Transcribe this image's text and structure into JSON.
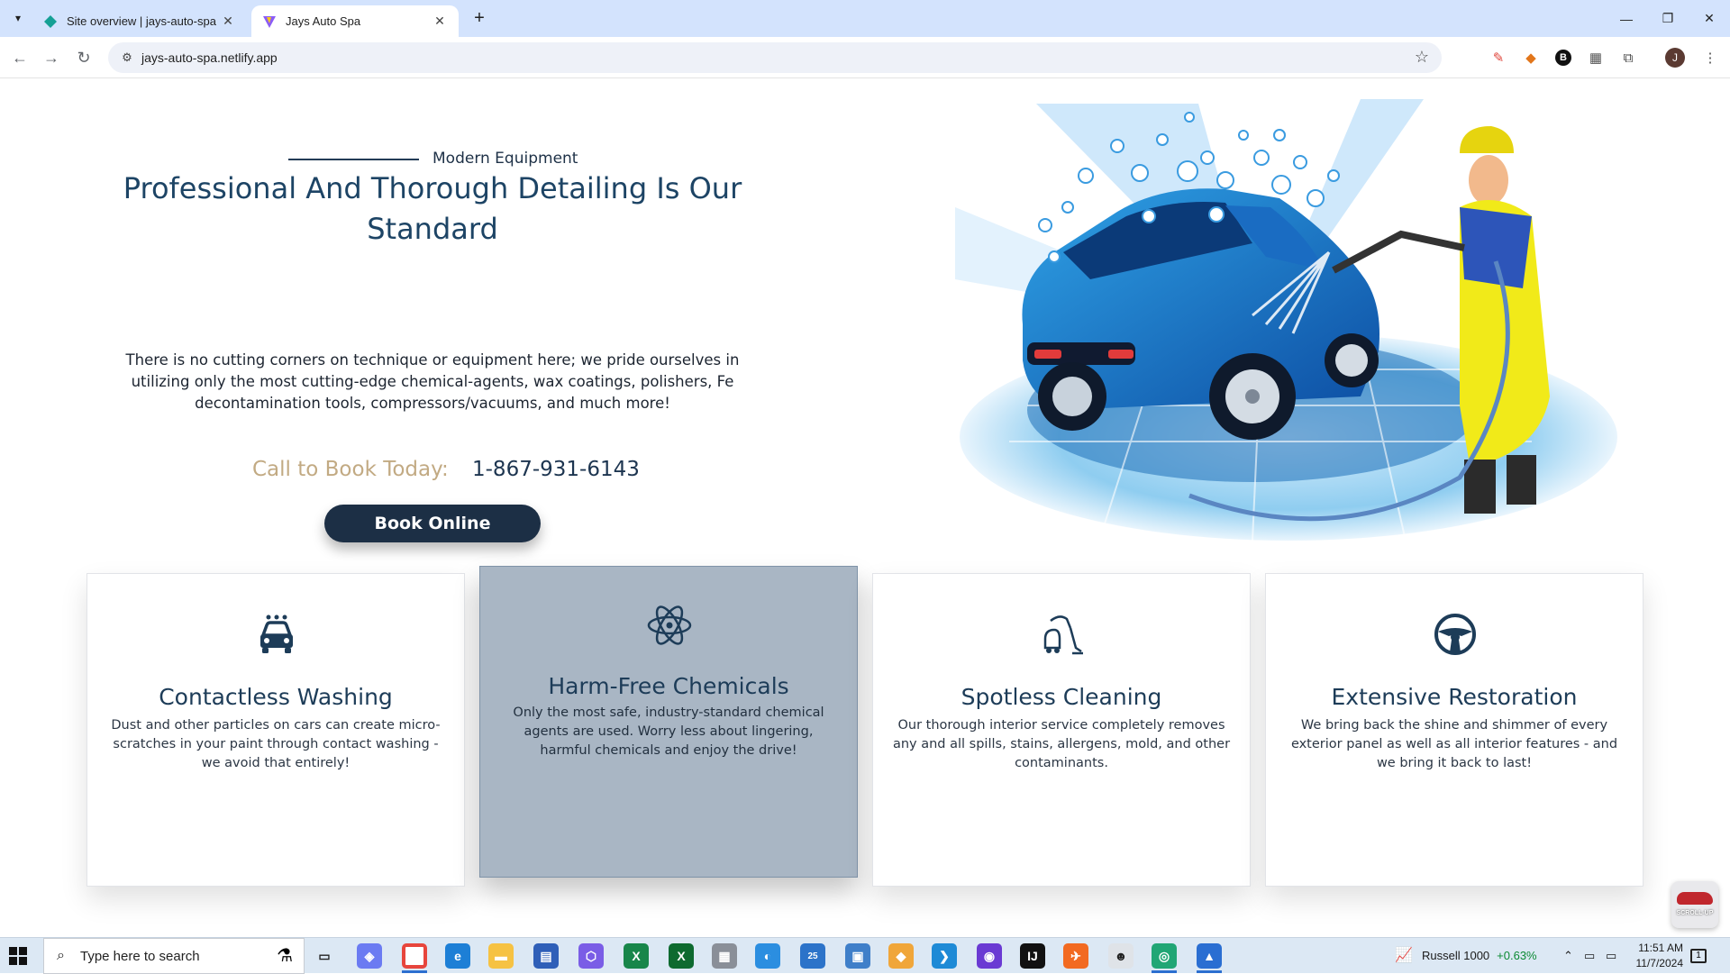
{
  "browser": {
    "tabs": [
      {
        "label": "Site overview | jays-auto-spa | N",
        "active": false
      },
      {
        "label": "Jays Auto Spa",
        "active": true
      }
    ],
    "url": "jays-auto-spa.netlify.app",
    "profile_initial": "J"
  },
  "hero": {
    "eyebrow": "Modern Equipment",
    "headline": "Professional And Thorough Detailing Is Our Standard",
    "description": "There is no cutting corners on technique or equipment here; we pride ourselves in utilizing only the most cutting-edge chemical-agents, wax coatings, polishers, Fe decontamination tools, compressors/vacuums, and much more!",
    "call_label": "Call to Book Today:",
    "phone": "1-867-931-6143",
    "book_button": "Book Online"
  },
  "features": [
    {
      "icon": "car-wash-icon",
      "title": "Contactless Washing",
      "body": "Dust and other particles on cars can create micro-scratches in your paint through contact washing - we avoid that entirely!"
    },
    {
      "icon": "atom-icon",
      "title": "Harm-Free Chemicals",
      "body": "Only the most safe, industry-standard chemical agents are used. Worry less about lingering, harmful chemicals and enjoy the drive!",
      "highlighted": true
    },
    {
      "icon": "vacuum-icon",
      "title": "Spotless Cleaning",
      "body": "Our thorough interior service completely removes any and all spills, stains, allergens, mold, and other contaminants."
    },
    {
      "icon": "steering-wheel-icon",
      "title": "Extensive Restoration",
      "body": "We bring back the shine and shimmer of every exterior panel as well as all interior features - and we bring it back to last!"
    }
  ],
  "scroll_up": "SCROLL-UP",
  "taskbar": {
    "search_placeholder": "Type here to search",
    "mail_badge": "25",
    "stock_name": "Russell 1000",
    "stock_change": "+0.63%",
    "time": "11:51 AM",
    "date": "11/7/2024",
    "notification_count": "1"
  },
  "colors": {
    "navy": "#1c2f45",
    "headline": "#1d4465",
    "gold": "#c2aa83",
    "highlight_card": "#a9b6c4"
  }
}
